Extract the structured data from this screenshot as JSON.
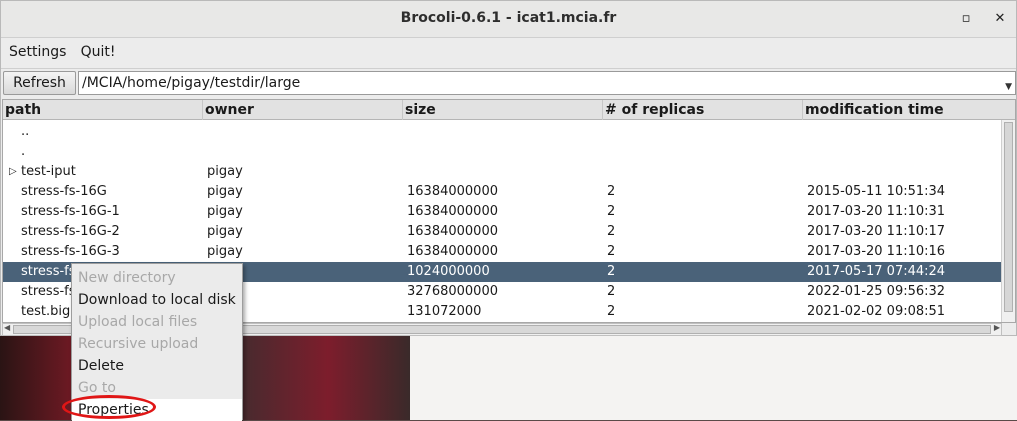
{
  "window": {
    "title": "Brocoli-0.6.1 - icat1.mcia.fr",
    "maximize_glyph": "▫",
    "close_glyph": "✕"
  },
  "menubar": {
    "items": [
      "Settings",
      "Quit!"
    ]
  },
  "toolbar": {
    "refresh_label": "Refresh",
    "path_value": "/MCIA/home/pigay/testdir/large"
  },
  "table": {
    "columns": [
      "path",
      "owner",
      "size",
      "# of replicas",
      "modification time"
    ],
    "rows": [
      {
        "path": "..",
        "owner": "",
        "size": "",
        "replicas": "",
        "mtime": ""
      },
      {
        "path": ".",
        "owner": "",
        "size": "",
        "replicas": "",
        "mtime": ""
      },
      {
        "path": "test-iput",
        "owner": "pigay",
        "size": "",
        "replicas": "",
        "mtime": "",
        "expandable": true
      },
      {
        "path": "stress-fs-16G",
        "owner": "pigay",
        "size": "16384000000",
        "replicas": "2",
        "mtime": "2015-05-11 10:51:34"
      },
      {
        "path": "stress-fs-16G-1",
        "owner": "pigay",
        "size": "16384000000",
        "replicas": "2",
        "mtime": "2017-03-20 11:10:31"
      },
      {
        "path": "stress-fs-16G-2",
        "owner": "pigay",
        "size": "16384000000",
        "replicas": "2",
        "mtime": "2017-03-20 11:10:17"
      },
      {
        "path": "stress-fs-16G-3",
        "owner": "pigay",
        "size": "16384000000",
        "replicas": "2",
        "mtime": "2017-03-20 11:10:16"
      },
      {
        "path": "stress-fs",
        "owner": "",
        "size": "1024000000",
        "replicas": "2",
        "mtime": "2017-05-17 07:44:24",
        "selected": true
      },
      {
        "path": "stress-fs",
        "owner": "",
        "size": "32768000000",
        "replicas": "2",
        "mtime": "2022-01-25 09:56:32"
      },
      {
        "path": "test.big",
        "owner": "",
        "size": "131072000",
        "replicas": "2",
        "mtime": "2021-02-02 09:08:51"
      }
    ]
  },
  "context_menu": {
    "items": [
      {
        "label": "New directory",
        "enabled": false
      },
      {
        "label": "Download to local disk",
        "enabled": true
      },
      {
        "label": "Upload local files",
        "enabled": false
      },
      {
        "label": "Recursive upload",
        "enabled": false
      },
      {
        "label": "Delete",
        "enabled": true
      },
      {
        "label": "Go to",
        "enabled": false
      },
      {
        "label": "Properties",
        "enabled": true,
        "highlighted": true
      }
    ]
  },
  "colors": {
    "selection": "#4a6279",
    "annotation_circle": "#e01616"
  }
}
